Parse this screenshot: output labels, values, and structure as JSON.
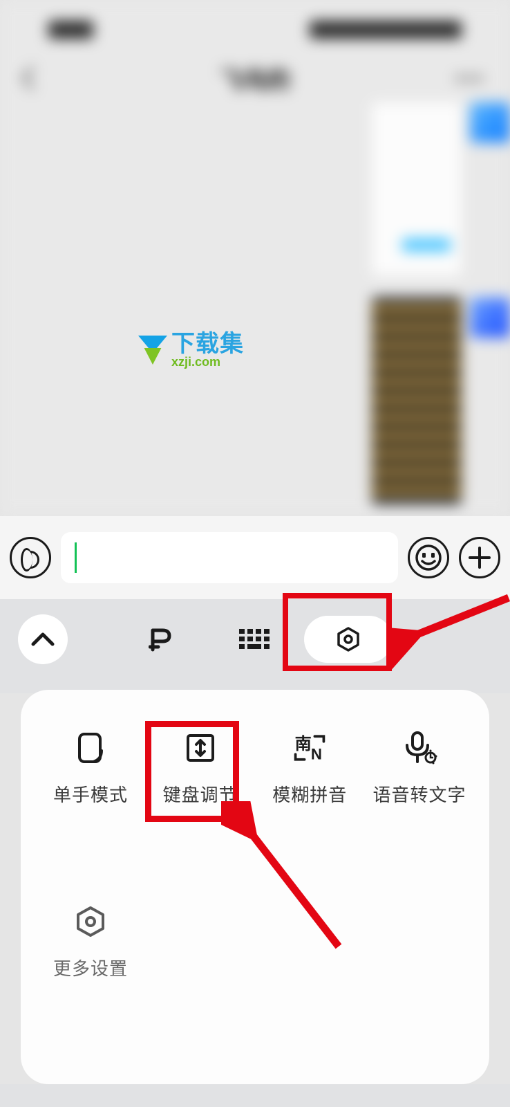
{
  "status": {
    "time": "19:23",
    "right": "4.1K/s 5G"
  },
  "chat_title": "飞鸟的",
  "watermark": {
    "cn": "下载集",
    "en": "xzji.com"
  },
  "input": {
    "placeholder": ""
  },
  "toolbar": {
    "tabs": {
      "p": "P",
      "grid": "grid",
      "settings": "settings"
    }
  },
  "settings": {
    "items": [
      {
        "key": "one_hand",
        "label": "单手模式"
      },
      {
        "key": "kbd_adjust",
        "label": "键盘调节"
      },
      {
        "key": "fuzzy_pinyin",
        "label": "模糊拼音"
      },
      {
        "key": "voice_text",
        "label": "语音转文字"
      }
    ],
    "more_label": "更多设置"
  },
  "annotations": {
    "highlight_tab": "settings",
    "highlight_item": "kbd_adjust"
  }
}
